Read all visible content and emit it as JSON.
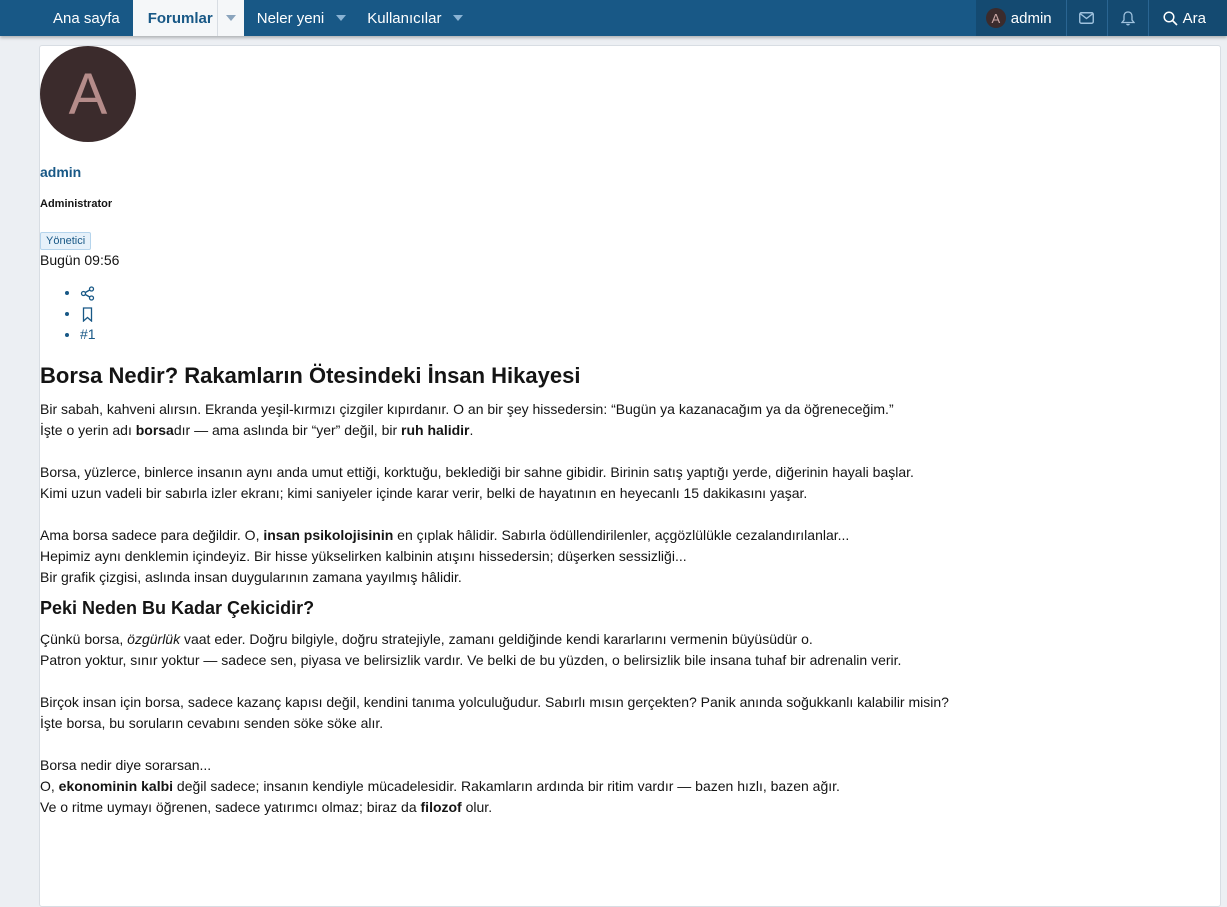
{
  "nav": {
    "home": "Ana sayfa",
    "forums": "Forumlar",
    "whats_new": "Neler yeni",
    "members": "Kullanıcılar",
    "account_initial": "A",
    "account_name": "admin",
    "search": "Ara"
  },
  "post": {
    "avatar_letter": "A",
    "username": "admin",
    "user_title": "Administrator",
    "role_badge": "Yönetici",
    "time": "Bugün 09:56",
    "post_number": "#1"
  },
  "article": {
    "title": "Borsa Nedir? Rakamların Ötesindeki İnsan Hikayesi",
    "p1_l1": "Bir sabah, kahveni alırsın. Ekranda yeşil-kırmızı çizgiler kıpırdanır. O an bir şey hissedersin: “Bugün ya kazanacağım ya da öğreneceğim.”",
    "p1_l2_a": "İşte o yerin adı ",
    "p1_l2_b": "borsa",
    "p1_l2_c": "dır — ama aslında bir “yer” değil, bir ",
    "p1_l2_d": "ruh halidir",
    "p1_l2_e": ".",
    "p2_l1": "Borsa, yüzlerce, binlerce insanın aynı anda umut ettiği, korktuğu, beklediği bir sahne gibidir. Birinin satış yaptığı yerde, diğerinin hayali başlar.",
    "p2_l2": "Kimi uzun vadeli bir sabırla izler ekranı; kimi saniyeler içinde karar verir, belki de hayatının en heyecanlı 15 dakikasını yaşar.",
    "p3_l1_a": "Ama borsa sadece para değildir. O, ",
    "p3_l1_b": "insan psikolojisinin",
    "p3_l1_c": " en çıplak hâlidir. Sabırla ödüllendirilenler, açgözlülükle cezalandırılanlar...",
    "p3_l2": "Hepimiz aynı denklemin içindeyiz. Bir hisse yükselirken kalbinin atışını hissedersin; düşerken sessizliği...",
    "p3_l3": "Bir grafik çizgisi, aslında insan duygularının zamana yayılmış hâlidir.",
    "subtitle": "Peki Neden Bu Kadar Çekicidir?",
    "p4_l1_a": "Çünkü borsa, ",
    "p4_l1_b": "özgürlük",
    "p4_l1_c": " vaat eder. Doğru bilgiyle, doğru stratejiyle, zamanı geldiğinde kendi kararlarını vermenin büyüsüdür o.",
    "p4_l2": "Patron yoktur, sınır yoktur — sadece sen, piyasa ve belirsizlik vardır. Ve belki de bu yüzden, o belirsizlik bile insana tuhaf bir adrenalin verir.",
    "p5_l1": "Birçok insan için borsa, sadece kazanç kapısı değil, kendini tanıma yolculuğudur. Sabırlı mısın gerçekten? Panik anında soğukkanlı kalabilir misin?",
    "p5_l2": "İşte borsa, bu soruların cevabını senden söke söke alır.",
    "p6_l1": "Borsa nedir diye sorarsan...",
    "p6_l2_a": "O, ",
    "p6_l2_b": "ekonominin kalbi",
    "p6_l2_c": " değil sadece; insanın kendiyle mücadelesidir. Rakamların ardında bir ritim vardır — bazen hızlı, bazen ağır.",
    "p6_l3_a": "Ve o ritme uymayı öğrenen, sadece yatırımcı olmaz; biraz da ",
    "p6_l3_b": "filozof",
    "p6_l3_c": " olur."
  }
}
